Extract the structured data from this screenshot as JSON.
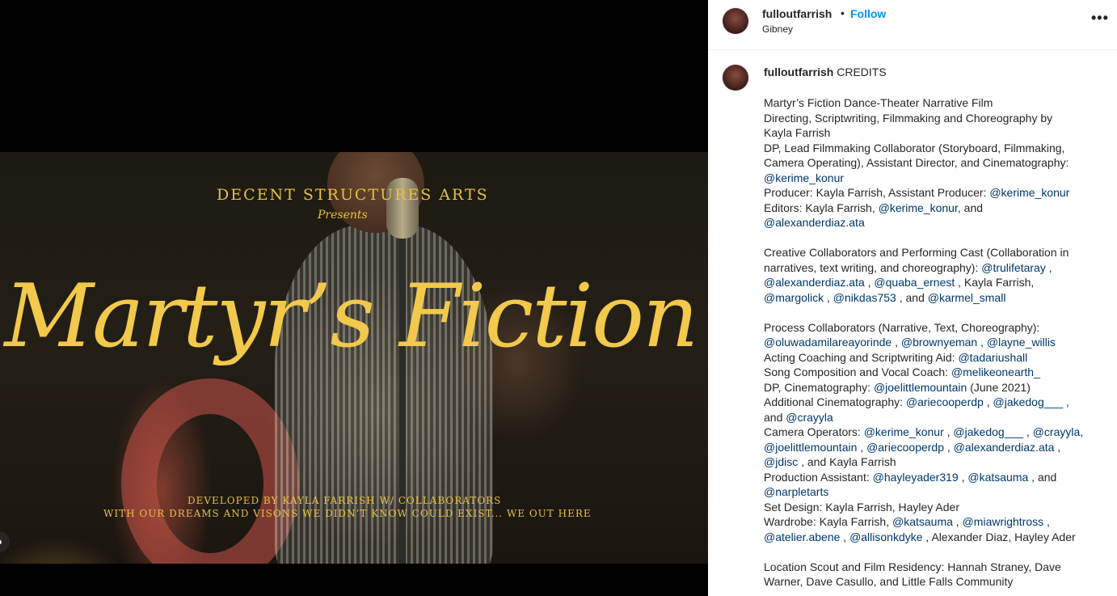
{
  "media": {
    "company": "DECENT STRUCTURES ARTS",
    "presents": "Presents",
    "title": "Martyr’s Fiction",
    "credit_line1": "DEVELOPED BY KAYLA FARRISH W/ COLLABORATORS",
    "credit_line2": "WITH OUR DREAMS AND VISONS WE DIDN’T KNOW COULD EXIST... WE OUT HERE"
  },
  "header": {
    "username": "fulloutfarrish",
    "separator": "•",
    "follow_label": "Follow",
    "location": "Gibney",
    "more_icon": "•••"
  },
  "caption": {
    "username": "fulloutfarrish",
    "first_word": "CREDITS",
    "lines": [
      [
        {
          "t": "Martyr’s Fiction Dance-Theater Narrative Film"
        }
      ],
      [
        {
          "t": "Directing, Scriptwriting, Filmmaking and Choreography by"
        }
      ],
      [
        {
          "t": "Kayla Farrish"
        }
      ],
      [
        {
          "t": "DP, Lead Filmmaking Collaborator (Storyboard, Filmmaking,"
        }
      ],
      [
        {
          "t": "Camera Operating), Assistant Director, and Cinematography:"
        }
      ],
      [
        {
          "m": "@kerime_konur"
        }
      ],
      [
        {
          "t": "Producer: Kayla Farrish, Assistant Producer: "
        },
        {
          "m": "@kerime_konur"
        }
      ],
      [
        {
          "t": "Editors: Kayla Farrish, "
        },
        {
          "m": "@kerime_konur"
        },
        {
          "t": ", and"
        }
      ],
      [
        {
          "m": "@alexanderdiaz.ata"
        }
      ],
      [],
      [
        {
          "t": "Creative Collaborators and Performing Cast (Collaboration in"
        }
      ],
      [
        {
          "t": "narratives, text writing, and choreography): "
        },
        {
          "m": "@trulifetaray"
        },
        {
          "t": " ,"
        }
      ],
      [
        {
          "m": "@alexanderdiaz.ata"
        },
        {
          "t": " , "
        },
        {
          "m": "@quaba_ernest"
        },
        {
          "t": " , Kayla Farrish,"
        }
      ],
      [
        {
          "m": "@margolick"
        },
        {
          "t": " , "
        },
        {
          "m": "@nikdas753"
        },
        {
          "t": " , and "
        },
        {
          "m": "@karmel_small"
        }
      ],
      [],
      [
        {
          "t": "Process Collaborators (Narrative, Text, Choreography):"
        }
      ],
      [
        {
          "m": "@oluwadamilareayorinde"
        },
        {
          "t": " , "
        },
        {
          "m": "@brownyeman"
        },
        {
          "t": " , "
        },
        {
          "m": "@layne_willis"
        }
      ],
      [
        {
          "t": "Acting Coaching and Scriptwriting Aid: "
        },
        {
          "m": "@tadariushall"
        }
      ],
      [
        {
          "t": "Song Composition and Vocal Coach: "
        },
        {
          "m": "@melikeonearth_"
        }
      ],
      [
        {
          "t": "DP, Cinematography: "
        },
        {
          "m": "@joelittlemountain"
        },
        {
          "t": " (June 2021)"
        }
      ],
      [
        {
          "t": "Additional Cinematography: "
        },
        {
          "m": "@ariecooperdp"
        },
        {
          "t": " , "
        },
        {
          "m": "@jakedog___"
        },
        {
          "t": " ,"
        }
      ],
      [
        {
          "t": "and "
        },
        {
          "m": "@crayyla"
        }
      ],
      [
        {
          "t": "Camera Operators: "
        },
        {
          "m": "@kerime_konur"
        },
        {
          "t": " , "
        },
        {
          "m": "@jakedog___"
        },
        {
          "t": " , "
        },
        {
          "m": "@crayyla"
        },
        {
          "t": ","
        }
      ],
      [
        {
          "m": "@joelittlemountain"
        },
        {
          "t": " , "
        },
        {
          "m": "@ariecooperdp"
        },
        {
          "t": " , "
        },
        {
          "m": "@alexanderdiaz.ata"
        },
        {
          "t": " ,"
        }
      ],
      [
        {
          "m": "@jdisc"
        },
        {
          "t": " , and Kayla Farrish"
        }
      ],
      [
        {
          "t": "Production Assistant: "
        },
        {
          "m": "@hayleyader319"
        },
        {
          "t": " , "
        },
        {
          "m": "@katsauma"
        },
        {
          "t": " , and"
        }
      ],
      [
        {
          "m": "@narpletarts"
        }
      ],
      [
        {
          "t": "Set Design: Kayla Farrish, Hayley Ader"
        }
      ],
      [
        {
          "t": "Wardrobe: Kayla Farrish, "
        },
        {
          "m": "@katsauma"
        },
        {
          "t": " , "
        },
        {
          "m": "@miawrightross"
        },
        {
          "t": " ,"
        }
      ],
      [
        {
          "m": "@atelier.abene"
        },
        {
          "t": " , "
        },
        {
          "m": "@allisonkdyke"
        },
        {
          "t": " , Alexander Diaz, Hayley Ader"
        }
      ],
      [],
      [
        {
          "t": "Location Scout and Film Residency: Hannah Straney, Dave"
        }
      ],
      [
        {
          "t": "Warner, Dave Casullo, and Little Falls Community"
        }
      ]
    ]
  }
}
